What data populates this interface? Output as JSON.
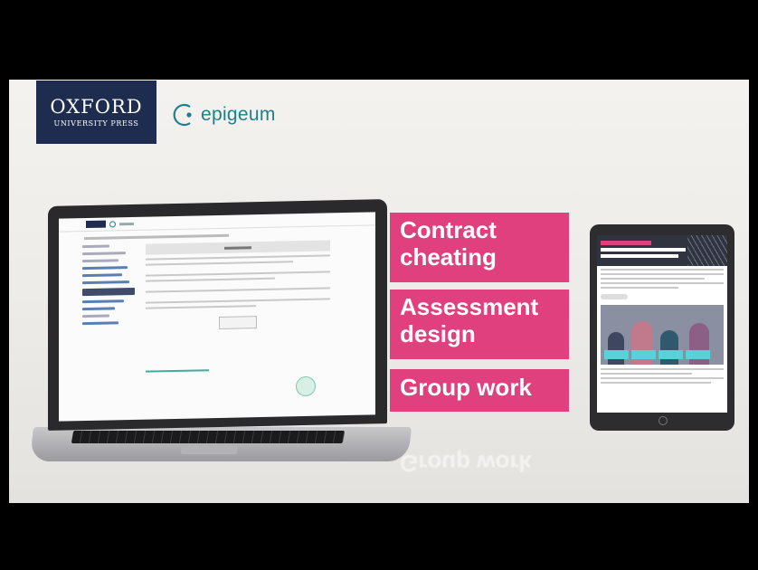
{
  "logos": {
    "oxford_line1": "OXFORD",
    "oxford_line2": "UNIVERSITY PRESS",
    "epigeum": "epigeum"
  },
  "labels": [
    {
      "line1": "Contract",
      "line2": "cheating"
    },
    {
      "line1": "Assessment",
      "line2": "design"
    },
    {
      "line1": "Group work"
    }
  ],
  "reflection": "Group work",
  "colors": {
    "accent_pink": "#e0407d",
    "oxford_navy": "#1e2d4f",
    "epigeum_teal": "#1f7f8d"
  }
}
